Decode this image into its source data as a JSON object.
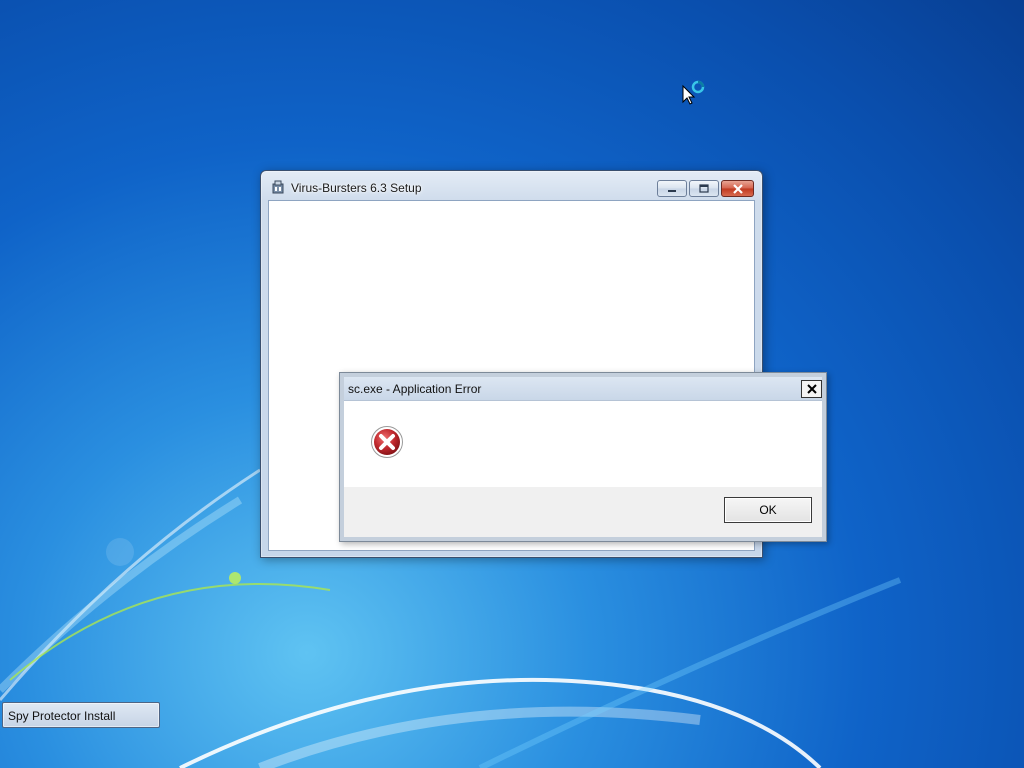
{
  "desktop": {
    "background_color": "#1565c8"
  },
  "setup_window": {
    "title": "Virus-Bursters 6.3 Setup",
    "icon": "installer-icon",
    "buttons": {
      "minimize": "minimize-icon",
      "maximize": "maximize-icon",
      "close": "close-icon"
    }
  },
  "error_dialog": {
    "title": "sc.exe - Application Error",
    "icon": "error-icon",
    "message": "",
    "ok_label": "OK",
    "close_icon": "close-icon"
  },
  "minimized_window": {
    "label": "Spy Protector Install"
  },
  "colors": {
    "accent": "#1565c8",
    "error_red": "#c0282d",
    "close_button": "#c0381f"
  }
}
